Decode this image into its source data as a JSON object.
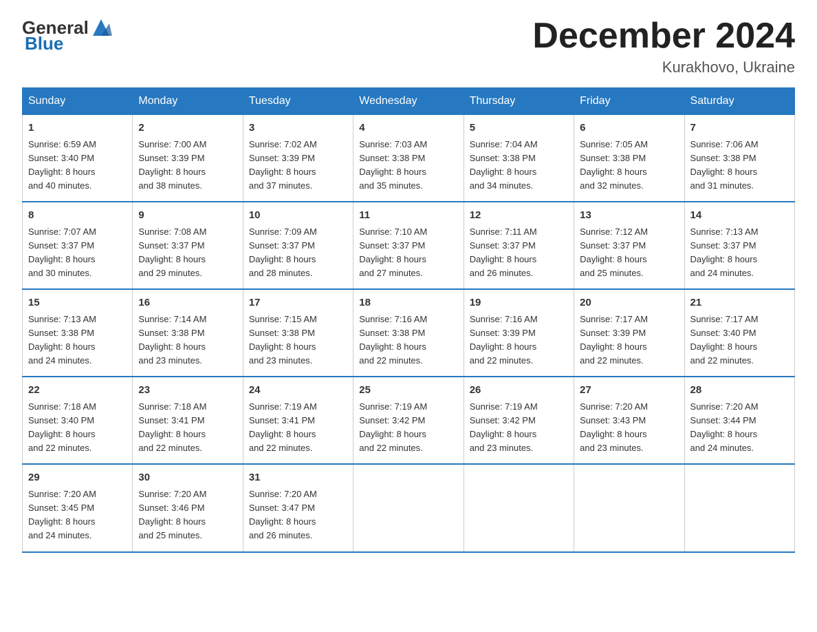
{
  "logo": {
    "general": "General",
    "blue": "Blue"
  },
  "title": "December 2024",
  "location": "Kurakhovo, Ukraine",
  "days_of_week": [
    "Sunday",
    "Monday",
    "Tuesday",
    "Wednesday",
    "Thursday",
    "Friday",
    "Saturday"
  ],
  "weeks": [
    [
      {
        "day": "1",
        "info": "Sunrise: 6:59 AM\nSunset: 3:40 PM\nDaylight: 8 hours\nand 40 minutes."
      },
      {
        "day": "2",
        "info": "Sunrise: 7:00 AM\nSunset: 3:39 PM\nDaylight: 8 hours\nand 38 minutes."
      },
      {
        "day": "3",
        "info": "Sunrise: 7:02 AM\nSunset: 3:39 PM\nDaylight: 8 hours\nand 37 minutes."
      },
      {
        "day": "4",
        "info": "Sunrise: 7:03 AM\nSunset: 3:38 PM\nDaylight: 8 hours\nand 35 minutes."
      },
      {
        "day": "5",
        "info": "Sunrise: 7:04 AM\nSunset: 3:38 PM\nDaylight: 8 hours\nand 34 minutes."
      },
      {
        "day": "6",
        "info": "Sunrise: 7:05 AM\nSunset: 3:38 PM\nDaylight: 8 hours\nand 32 minutes."
      },
      {
        "day": "7",
        "info": "Sunrise: 7:06 AM\nSunset: 3:38 PM\nDaylight: 8 hours\nand 31 minutes."
      }
    ],
    [
      {
        "day": "8",
        "info": "Sunrise: 7:07 AM\nSunset: 3:37 PM\nDaylight: 8 hours\nand 30 minutes."
      },
      {
        "day": "9",
        "info": "Sunrise: 7:08 AM\nSunset: 3:37 PM\nDaylight: 8 hours\nand 29 minutes."
      },
      {
        "day": "10",
        "info": "Sunrise: 7:09 AM\nSunset: 3:37 PM\nDaylight: 8 hours\nand 28 minutes."
      },
      {
        "day": "11",
        "info": "Sunrise: 7:10 AM\nSunset: 3:37 PM\nDaylight: 8 hours\nand 27 minutes."
      },
      {
        "day": "12",
        "info": "Sunrise: 7:11 AM\nSunset: 3:37 PM\nDaylight: 8 hours\nand 26 minutes."
      },
      {
        "day": "13",
        "info": "Sunrise: 7:12 AM\nSunset: 3:37 PM\nDaylight: 8 hours\nand 25 minutes."
      },
      {
        "day": "14",
        "info": "Sunrise: 7:13 AM\nSunset: 3:37 PM\nDaylight: 8 hours\nand 24 minutes."
      }
    ],
    [
      {
        "day": "15",
        "info": "Sunrise: 7:13 AM\nSunset: 3:38 PM\nDaylight: 8 hours\nand 24 minutes."
      },
      {
        "day": "16",
        "info": "Sunrise: 7:14 AM\nSunset: 3:38 PM\nDaylight: 8 hours\nand 23 minutes."
      },
      {
        "day": "17",
        "info": "Sunrise: 7:15 AM\nSunset: 3:38 PM\nDaylight: 8 hours\nand 23 minutes."
      },
      {
        "day": "18",
        "info": "Sunrise: 7:16 AM\nSunset: 3:38 PM\nDaylight: 8 hours\nand 22 minutes."
      },
      {
        "day": "19",
        "info": "Sunrise: 7:16 AM\nSunset: 3:39 PM\nDaylight: 8 hours\nand 22 minutes."
      },
      {
        "day": "20",
        "info": "Sunrise: 7:17 AM\nSunset: 3:39 PM\nDaylight: 8 hours\nand 22 minutes."
      },
      {
        "day": "21",
        "info": "Sunrise: 7:17 AM\nSunset: 3:40 PM\nDaylight: 8 hours\nand 22 minutes."
      }
    ],
    [
      {
        "day": "22",
        "info": "Sunrise: 7:18 AM\nSunset: 3:40 PM\nDaylight: 8 hours\nand 22 minutes."
      },
      {
        "day": "23",
        "info": "Sunrise: 7:18 AM\nSunset: 3:41 PM\nDaylight: 8 hours\nand 22 minutes."
      },
      {
        "day": "24",
        "info": "Sunrise: 7:19 AM\nSunset: 3:41 PM\nDaylight: 8 hours\nand 22 minutes."
      },
      {
        "day": "25",
        "info": "Sunrise: 7:19 AM\nSunset: 3:42 PM\nDaylight: 8 hours\nand 22 minutes."
      },
      {
        "day": "26",
        "info": "Sunrise: 7:19 AM\nSunset: 3:42 PM\nDaylight: 8 hours\nand 23 minutes."
      },
      {
        "day": "27",
        "info": "Sunrise: 7:20 AM\nSunset: 3:43 PM\nDaylight: 8 hours\nand 23 minutes."
      },
      {
        "day": "28",
        "info": "Sunrise: 7:20 AM\nSunset: 3:44 PM\nDaylight: 8 hours\nand 24 minutes."
      }
    ],
    [
      {
        "day": "29",
        "info": "Sunrise: 7:20 AM\nSunset: 3:45 PM\nDaylight: 8 hours\nand 24 minutes."
      },
      {
        "day": "30",
        "info": "Sunrise: 7:20 AM\nSunset: 3:46 PM\nDaylight: 8 hours\nand 25 minutes."
      },
      {
        "day": "31",
        "info": "Sunrise: 7:20 AM\nSunset: 3:47 PM\nDaylight: 8 hours\nand 26 minutes."
      },
      {
        "day": "",
        "info": ""
      },
      {
        "day": "",
        "info": ""
      },
      {
        "day": "",
        "info": ""
      },
      {
        "day": "",
        "info": ""
      }
    ]
  ]
}
